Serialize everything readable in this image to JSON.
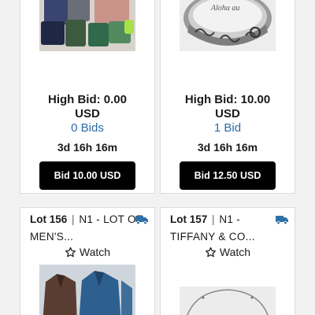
{
  "cards": [
    {
      "high_bid": "High Bid: 0.00",
      "currency": "USD",
      "bids": "0 Bids",
      "time_left": "3d 16h 16m",
      "button": "Bid 10.00 USD"
    },
    {
      "high_bid": "High Bid: 10.00",
      "currency": "USD",
      "bids": "1 Bid",
      "time_left": "3d 16h 16m",
      "button": "Bid 12.50 USD",
      "ring_engraving": "Aloha au"
    },
    {
      "lot_label": "Lot 156",
      "separator": "|",
      "title": "N1 - LOT OF MEN'S...",
      "watch": "Watch"
    },
    {
      "lot_label": "Lot 157",
      "separator": "|",
      "title": "N1 - TIFFANY & CO...",
      "watch": "Watch"
    }
  ],
  "colors": {
    "accent_link": "#2e6aa8",
    "button_bg": "#000000",
    "shipping_icon": "#2f6fa8"
  },
  "icons": [
    "truck-icon",
    "star-outline-icon"
  ]
}
